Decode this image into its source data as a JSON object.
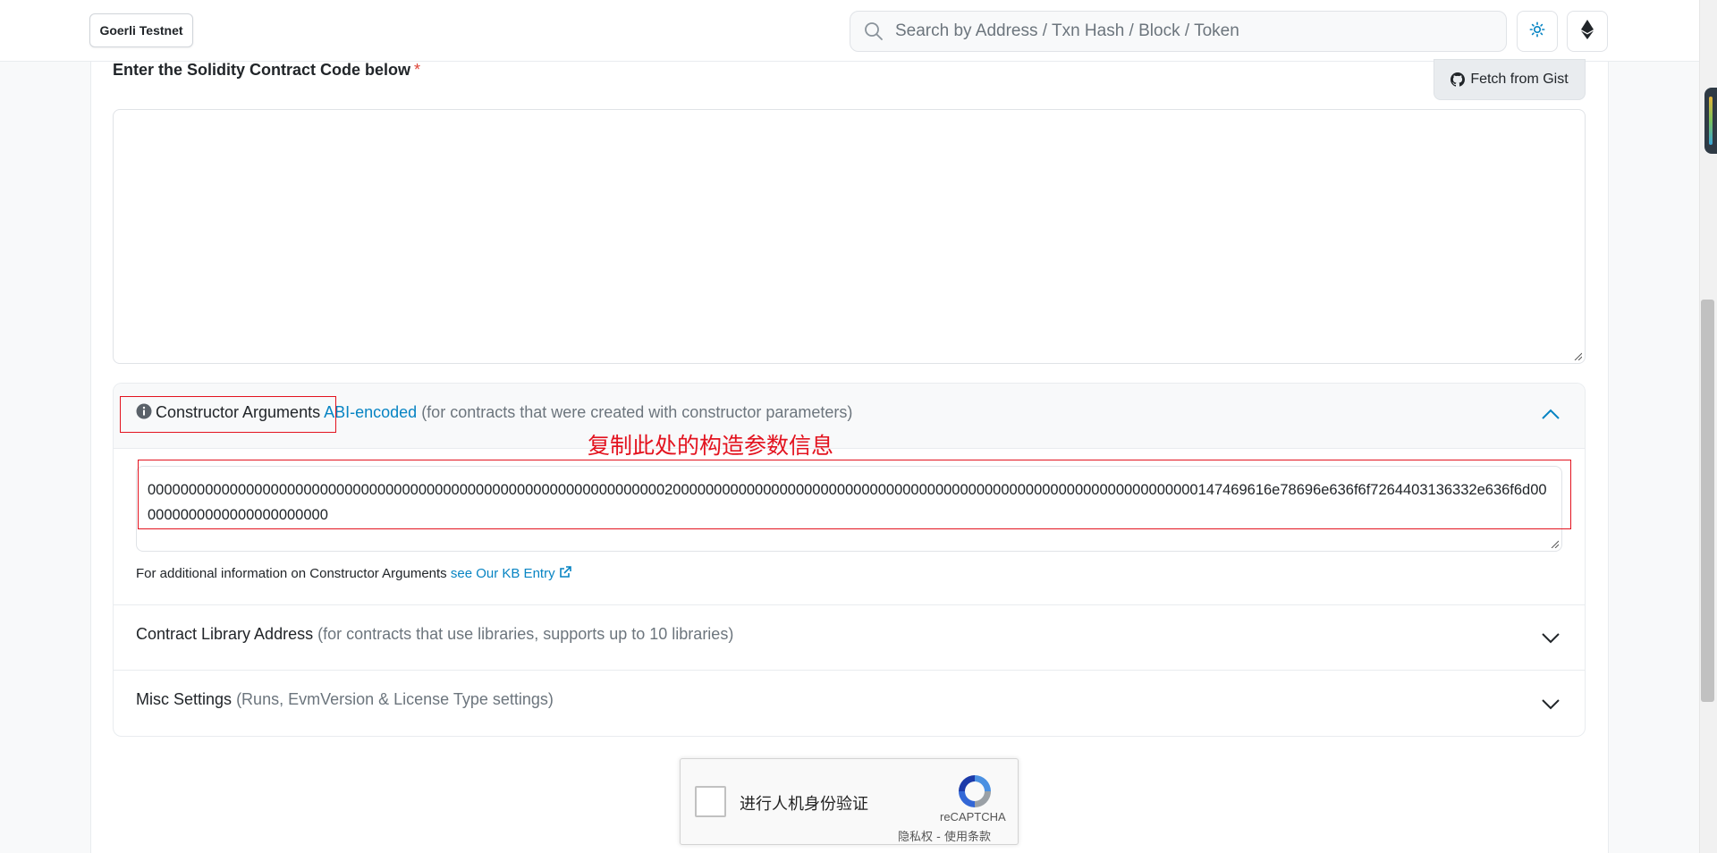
{
  "header": {
    "network_badge": "Goerli Testnet",
    "search_placeholder": "Search by Address / Txn Hash / Block / Token"
  },
  "code_section": {
    "label": "Enter the Solidity Contract Code below",
    "required_mark": "*",
    "fetch_button": "Fetch from Gist",
    "code_value": ""
  },
  "constructor": {
    "title": "Constructor Arguments",
    "link": "ABI-encoded",
    "subtitle": "(for contracts that were created with constructor parameters)",
    "value": "00000000000000000000000000000000000000000000000000000000000000020000000000000000000000000000000000000000000000000000000000000000147469616e78696e636f6f7264403136332e636f6d000000000000000000000000",
    "kb_text": "For additional information on Constructor Arguments",
    "kb_link": "see Our KB Entry"
  },
  "library": {
    "title": "Contract Library Address",
    "subtitle": "(for contracts that use libraries, supports up to 10 libraries)"
  },
  "misc": {
    "title": "Misc Settings",
    "subtitle": "(Runs, EvmVersion & License Type settings)"
  },
  "annotation": {
    "text": "复制此处的构造参数信息",
    "color": "#e3131f"
  },
  "recaptcha": {
    "label": "进行人机身份验证",
    "brand": "reCAPTCHA",
    "privacy": "隐私权",
    "separator": " - ",
    "terms": "使用条款"
  },
  "colors": {
    "link": "#0784c3",
    "annotation": "#e3131f"
  }
}
